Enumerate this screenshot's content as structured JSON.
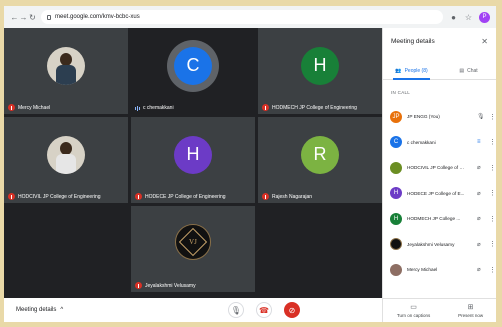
{
  "browser": {
    "url": "meet.google.com/kmv-bcbc-xus",
    "profile_initial": "P"
  },
  "tiles": [
    {
      "name": "Mercy Michael",
      "avatar_type": "photo",
      "muted": true
    },
    {
      "name": "c chemakkani",
      "avatar_letter": "C",
      "avatar_color": "#1a73e8",
      "speaking": true
    },
    {
      "name": "HODMECH JP College of Engineering",
      "avatar_letter": "H",
      "avatar_color": "#188038",
      "muted": true
    },
    {
      "name": "HODCIVIL JP College of Engineering",
      "avatar_type": "photo",
      "muted": true
    },
    {
      "name": "HODECE JP College of Engineering",
      "avatar_letter": "H",
      "avatar_color": "#6c3bc6",
      "muted": true
    },
    {
      "name": "Rajesh Nagarajan",
      "avatar_letter": "R",
      "avatar_color": "#7cb342",
      "muted": true
    },
    {
      "name": "Jeyalakshmi Velusamy",
      "avatar_type": "logo",
      "logo_text": "VJ",
      "muted": true
    }
  ],
  "bottom_bar": {
    "meeting_details": "Meeting details",
    "chevron": "^"
  },
  "panel": {
    "title": "Meeting details",
    "close": "✕",
    "tabs": {
      "people": "People (8)",
      "chat": "Chat"
    },
    "in_call": "IN CALL",
    "participants": [
      {
        "name": "JP ENGG (You)",
        "avatar": "JP",
        "color": "#e8710a",
        "mic": "on"
      },
      {
        "name": "c chemakkani",
        "avatar": "C",
        "color": "#1a73e8",
        "mic": "speaking"
      },
      {
        "name": "HODCIVIL JP College of E...",
        "avatar": "",
        "color": "#6b8e23",
        "mic": "off"
      },
      {
        "name": "HODECE JP College of E...",
        "avatar": "H",
        "color": "#6c3bc6",
        "mic": "off"
      },
      {
        "name": "HODMECH JP College ...",
        "avatar": "H",
        "color": "#188038",
        "mic": "off"
      },
      {
        "name": "Jeyalakshmi Velusamy",
        "avatar": "",
        "color": "#111111",
        "mic": "off"
      },
      {
        "name": "Mercy Michael",
        "avatar": "",
        "color": "#8d6e63",
        "mic": "off"
      }
    ],
    "bottom": {
      "captions": "Turn on captions",
      "present": "Present now"
    }
  }
}
